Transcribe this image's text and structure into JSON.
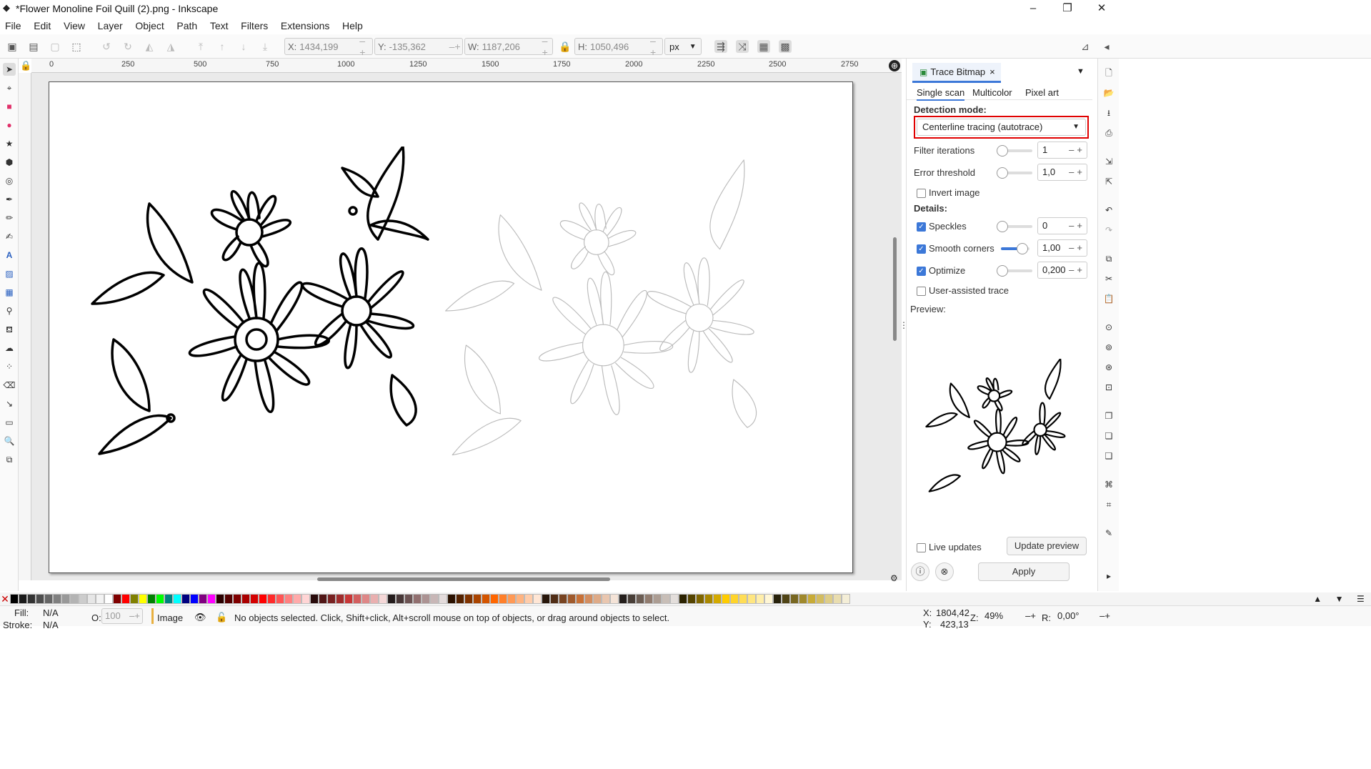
{
  "window": {
    "title": "*Flower Monoline Foil Quill (2).png - Inkscape",
    "minimize": "–",
    "maximize": "❐",
    "close": "✕"
  },
  "menu": [
    "File",
    "Edit",
    "View",
    "Layer",
    "Object",
    "Path",
    "Text",
    "Filters",
    "Extensions",
    "Help"
  ],
  "toolbar": {
    "x_label": "X:",
    "x_value": "1434,199",
    "y_label": "Y:",
    "y_value": "-135,362",
    "w_label": "W:",
    "w_value": "1187,206",
    "h_label": "H:",
    "h_value": "1050,496",
    "unit": "px"
  },
  "ruler_ticks": [
    "0",
    "250",
    "500",
    "750",
    "1000",
    "1250",
    "1500",
    "1750",
    "2000",
    "2250",
    "2500",
    "2750"
  ],
  "panel": {
    "tab_title": "Trace Bitmap",
    "tab_close": "×",
    "subtabs": [
      "Single scan",
      "Multicolor",
      "Pixel art"
    ],
    "detection_mode_label": "Detection mode:",
    "detection_mode_value": "Centerline tracing (autotrace)",
    "filter_iterations_label": "Filter iterations",
    "filter_iterations_value": "1",
    "error_threshold_label": "Error threshold",
    "error_threshold_value": "1,0",
    "invert_image_label": "Invert image",
    "details_label": "Details:",
    "speckles_label": "Speckles",
    "speckles_value": "0",
    "smooth_corners_label": "Smooth corners",
    "smooth_corners_value": "1,00",
    "optimize_label": "Optimize",
    "optimize_value": "0,200",
    "user_assisted_label": "User-assisted trace",
    "preview_label": "Preview:",
    "live_updates_label": "Live updates",
    "update_preview_label": "Update preview",
    "apply_label": "Apply"
  },
  "palette_colors": [
    "#000000",
    "#1a1a1a",
    "#333333",
    "#4d4d4d",
    "#666666",
    "#808080",
    "#999999",
    "#b3b3b3",
    "#cccccc",
    "#e6e6e6",
    "#f2f2f2",
    "#ffffff",
    "#800000",
    "#ff0000",
    "#808000",
    "#ffff00",
    "#008000",
    "#00ff00",
    "#008080",
    "#00ffff",
    "#000080",
    "#0000ff",
    "#800080",
    "#ff00ff",
    "#2b0000",
    "#550000",
    "#800000",
    "#aa0000",
    "#d40000",
    "#ff0000",
    "#ff2a2a",
    "#ff5555",
    "#ff8080",
    "#ffaaaa",
    "#ffd5d5",
    "#280b0b",
    "#501616",
    "#782121",
    "#a02c2c",
    "#c83737",
    "#d35f5f",
    "#de8787",
    "#e9afaf",
    "#f4d7d7",
    "#241c1c",
    "#483737",
    "#6c5353",
    "#916f6f",
    "#ac9393",
    "#c8b7b7",
    "#e3dbdb",
    "#2b1100",
    "#552200",
    "#803300",
    "#aa4400",
    "#d45500",
    "#ff6600",
    "#ff7f2a",
    "#ff9955",
    "#ffb380",
    "#ffccaa",
    "#ffe6d5",
    "#28170b",
    "#502d16",
    "#784421",
    "#a05a2c",
    "#c87137",
    "#d38d5f",
    "#deaa87",
    "#e9c6af",
    "#f4e3d7",
    "#241f1c",
    "#483e37",
    "#6c5d53",
    "#917c6f",
    "#ac9d93",
    "#c8beb7",
    "#e3dedb",
    "#2b2200",
    "#554400",
    "#806600",
    "#aa8800",
    "#d4aa00",
    "#ffcc00",
    "#ffd42a",
    "#ffdd55",
    "#ffe680",
    "#ffeeaa",
    "#fff6d5",
    "#28220b",
    "#504416",
    "#786721",
    "#a0892c",
    "#c8ab37",
    "#d3bc5f",
    "#decd87",
    "#e9ddaf",
    "#f4eed7"
  ],
  "status": {
    "fill_label": "Fill:",
    "fill_value": "N/A",
    "stroke_label": "Stroke:",
    "stroke_value": "N/A",
    "opacity_label": "O:",
    "opacity_value": "100",
    "layer_name": "Image",
    "message": "No objects selected. Click, Shift+click, Alt+scroll mouse on top of objects, or drag around objects to select.",
    "cursor_x_label": "X:",
    "cursor_x": "1804,42",
    "cursor_y_label": "Y:",
    "cursor_y": "423,13",
    "zoom_label": "Z:",
    "zoom": "49%",
    "rotate_label": "R:",
    "rotate": "0,00°"
  },
  "colors": {
    "accent": "#3c78d8",
    "highlight_box": "#e00000"
  }
}
